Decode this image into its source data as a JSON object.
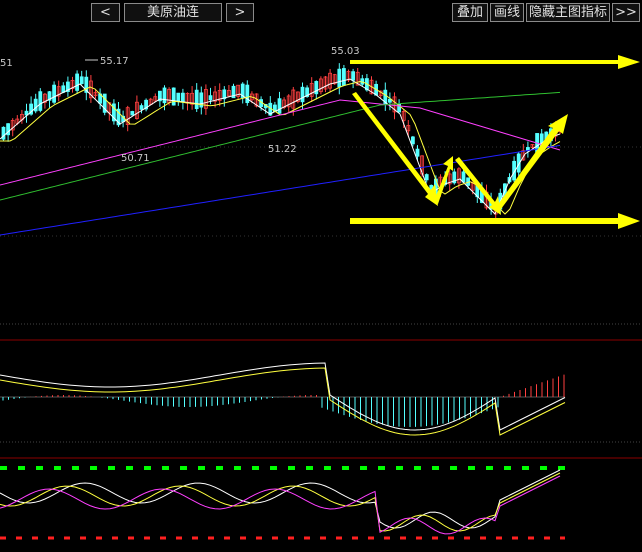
{
  "toolbar": {
    "prev_label": "<",
    "symbol": "美原油连",
    "next_label": ">",
    "overlay_label": "叠加",
    "draw_label": "画线",
    "hide_indicator_label": "隐藏主图指标",
    "more_label": ">>"
  },
  "chart_data": {
    "type": "candlestick",
    "price_labels": [
      "51",
      "55.17",
      "50.71",
      "55.03",
      "51.22"
    ],
    "colors": {
      "up_candle": "#ff4040",
      "down_candle": "#54ffff",
      "ma_short": "#ffffff",
      "ma_mid": "#ffff40",
      "ma_long_1": "#ff40ff",
      "ma_long_2": "#30c030",
      "ma_long_3": "#2020ff",
      "arrows": "#ffff00",
      "kdj_top_dash": "#00ff00",
      "kdj_bottom_dash": "#ff2020"
    }
  }
}
